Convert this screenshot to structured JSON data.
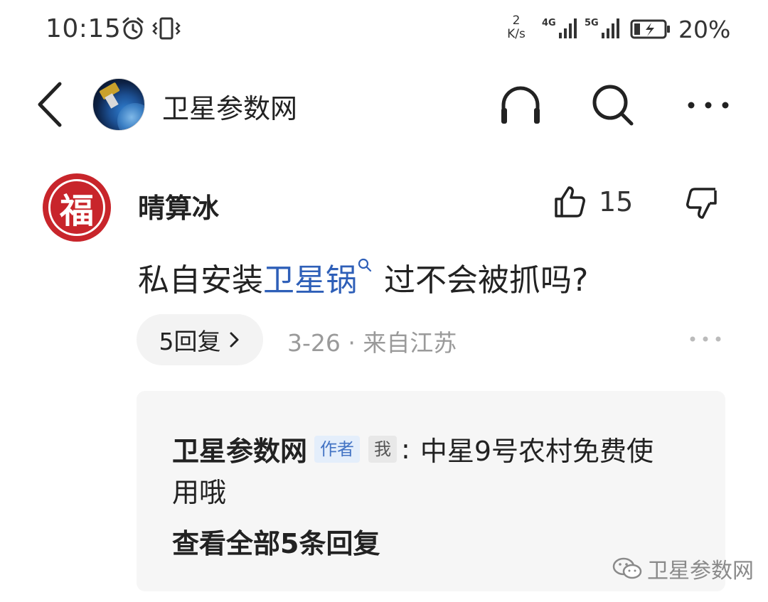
{
  "status_bar": {
    "time": "10:15",
    "speed_value": "2",
    "speed_unit": "K/s",
    "network1": "4G",
    "network2": "5G",
    "battery_percent": "20%",
    "battery_level": 0.2,
    "icons": [
      "alarm-icon",
      "vibrate-icon",
      "signal-icon",
      "signal-icon",
      "battery-charging-icon"
    ]
  },
  "header": {
    "channel_name": "卫星参数网",
    "icons": [
      "back-icon",
      "headphones-icon",
      "search-icon",
      "more-icon"
    ]
  },
  "comment": {
    "username": "晴算冰",
    "avatar_glyph": "福",
    "like_count": "15",
    "text_before": "私自安装",
    "text_link": "卫星锅",
    "text_after": "过不会被抓吗?",
    "reply_count_label": "5回复",
    "meta": "3-26 · 来自江苏"
  },
  "reply": {
    "author": "卫星参数网",
    "author_badge": "作者",
    "me_badge": "我",
    "colon": ":",
    "text_line1": "中星9号农村免费使",
    "text_line2": "用哦",
    "view_all_label": "查看全部5条回复"
  },
  "watermark": {
    "text": "卫星参数网"
  },
  "colors": {
    "link_blue": "#2e5fb8",
    "avatar_red": "#c8252b",
    "meta_gray": "#9a9a9a",
    "badge_blue_bg": "#e4eefb"
  }
}
